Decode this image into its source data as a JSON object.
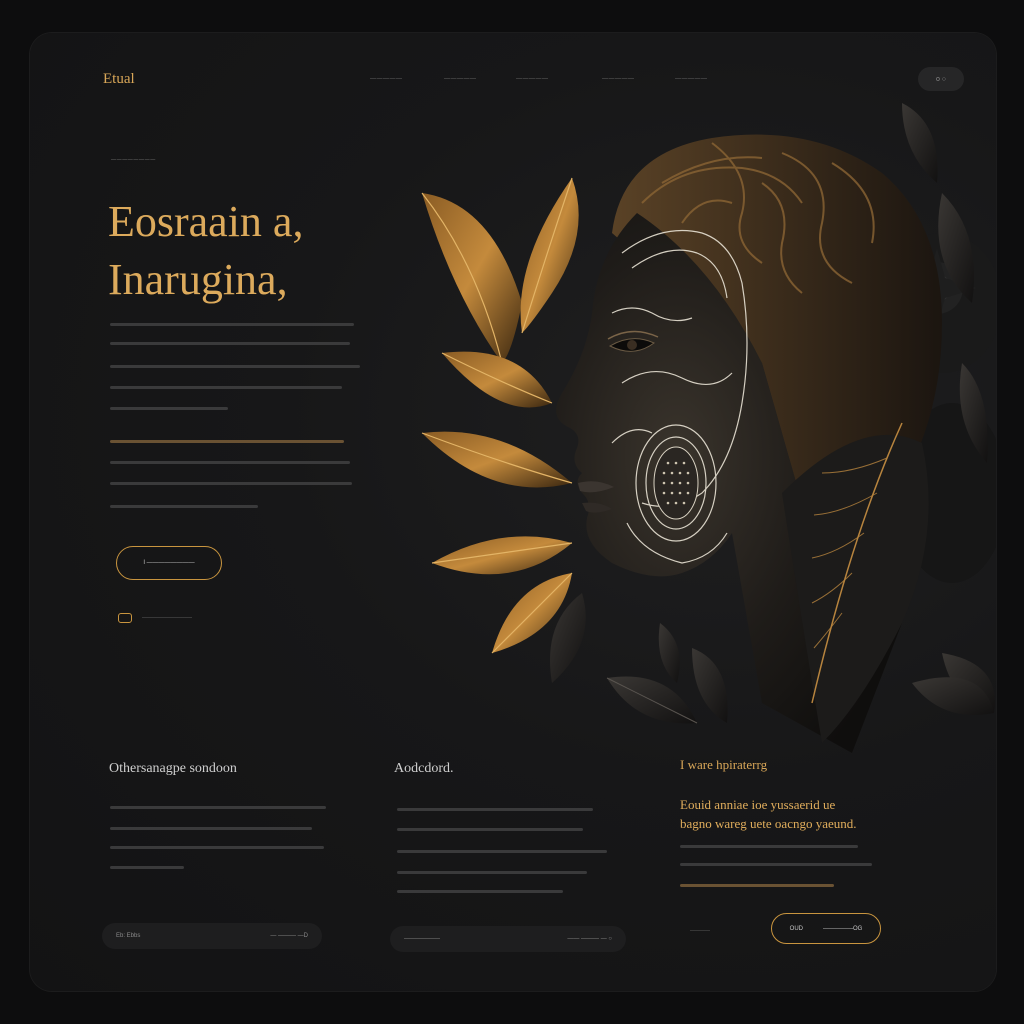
{
  "header": {
    "logo": "Etual",
    "nav": [
      "—————",
      "—————",
      "—————",
      "—————",
      "—————"
    ],
    "pill_label": "o ○"
  },
  "hero": {
    "eyebrow": "————————",
    "headline_line1": "Eosraain a,",
    "headline_line2": "Inarugina,",
    "cta_label": "I ————————",
    "small_link": "——————————"
  },
  "columns": [
    {
      "title": "Othersanagpe sondoon",
      "bar_left": "Eb: Ebbs",
      "bar_right": "— ——— —D"
    },
    {
      "title": "Aodcdord.",
      "bar_left": "——————",
      "bar_right": "—— ——— — ○"
    },
    {
      "title": "I ware hpiraterrg",
      "gold_text_line1": "Eouid anniae ioe yussaerid ue",
      "gold_text_line2": "bagno wareg uete oacngo yaeund.",
      "button_left": "OUD",
      "button_right": "—————OG"
    }
  ],
  "colors": {
    "accent_gold": "#d9a758",
    "background": "#0d0d0e",
    "card": "#171718"
  },
  "icons": [
    "link-icon",
    "face-illustration"
  ]
}
